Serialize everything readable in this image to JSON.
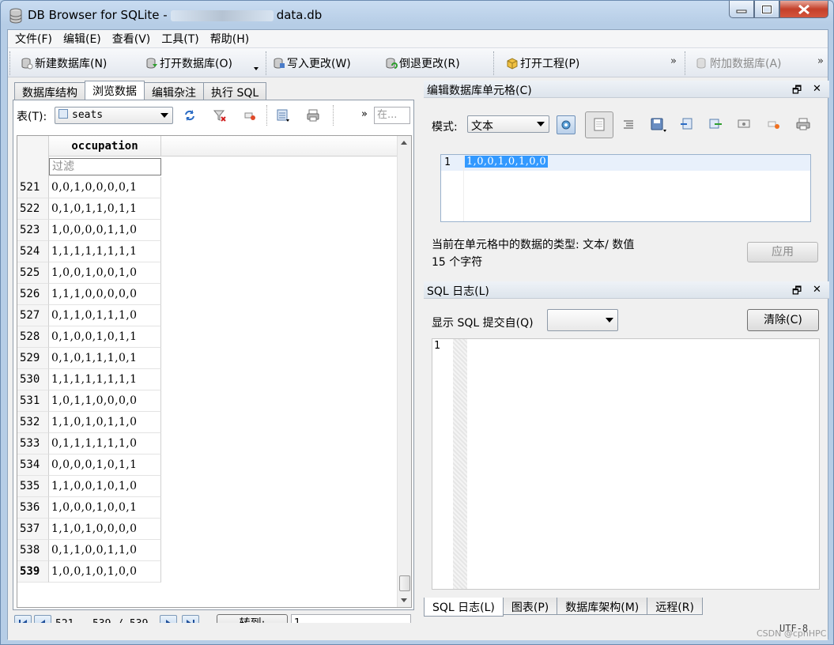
{
  "window": {
    "title_prefix": "DB Browser for SQLite -",
    "title_file": "data.db"
  },
  "menu": [
    "文件(F)",
    "编辑(E)",
    "查看(V)",
    "工具(T)",
    "帮助(H)"
  ],
  "toolbar": {
    "new_db": "新建数据库(N)",
    "open_db": "打开数据库(O)",
    "write_changes": "写入更改(W)",
    "revert_changes": "倒退更改(R)",
    "open_project": "打开工程(P)",
    "attach_db": "附加数据库(A)"
  },
  "tabs": [
    "数据库结构",
    "浏览数据",
    "编辑杂注",
    "执行 SQL"
  ],
  "browse": {
    "table_label": "表(T):",
    "table_value": "seats",
    "filter_more": "在...",
    "column_header": "occupation",
    "filter_placeholder": "过滤",
    "rows": [
      {
        "num": "521",
        "value": "0,0,1,0,0,0,0,1"
      },
      {
        "num": "522",
        "value": "0,1,0,1,1,0,1,1"
      },
      {
        "num": "523",
        "value": "1,0,0,0,0,1,1,0"
      },
      {
        "num": "524",
        "value": "1,1,1,1,1,1,1,1"
      },
      {
        "num": "525",
        "value": "1,0,0,1,0,0,1,0"
      },
      {
        "num": "526",
        "value": "1,1,1,0,0,0,0,0"
      },
      {
        "num": "527",
        "value": "0,1,1,0,1,1,1,0"
      },
      {
        "num": "528",
        "value": "0,1,0,0,1,0,1,1"
      },
      {
        "num": "529",
        "value": "0,1,0,1,1,1,0,1"
      },
      {
        "num": "530",
        "value": "1,1,1,1,1,1,1,1"
      },
      {
        "num": "531",
        "value": "1,0,1,1,0,0,0,0"
      },
      {
        "num": "532",
        "value": "1,1,0,1,0,1,1,0"
      },
      {
        "num": "533",
        "value": "0,1,1,1,1,1,1,0"
      },
      {
        "num": "534",
        "value": "0,0,0,0,1,0,1,1"
      },
      {
        "num": "535",
        "value": "1,1,0,0,1,0,1,0"
      },
      {
        "num": "536",
        "value": "1,0,0,0,1,0,0,1"
      },
      {
        "num": "537",
        "value": "1,1,0,1,0,0,0,0"
      },
      {
        "num": "538",
        "value": "0,1,1,0,0,1,1,0"
      },
      {
        "num": "539",
        "value": "1,0,0,1,0,1,0,0"
      }
    ],
    "nav_range": "521 - 539 / 539",
    "goto_label": "转到:",
    "goto_value": "1"
  },
  "cell_editor": {
    "title": "编辑数据库单元格(C)",
    "mode_label": "模式:",
    "mode_value": "文本",
    "line_no": "1",
    "content": "1,0,0,1,0,1,0,0",
    "type_info": "当前在单元格中的数据的类型: 文本/ 数值",
    "char_count": "15 个字符",
    "apply": "应用"
  },
  "sql_log": {
    "title": "SQL 日志(L)",
    "submitted_by_label": "显示 SQL 提交自(Q)",
    "clear": "清除(C)",
    "line_no": "1"
  },
  "bottom_tabs": [
    "SQL 日志(L)",
    "图表(P)",
    "数据库架构(M)",
    "远程(R)"
  ],
  "status": {
    "encoding": "UTF-8",
    "watermark": "CSDN @cpnHPC"
  },
  "dock_controls": {
    "float": "🗗",
    "close": "✕"
  },
  "chevron": "»"
}
